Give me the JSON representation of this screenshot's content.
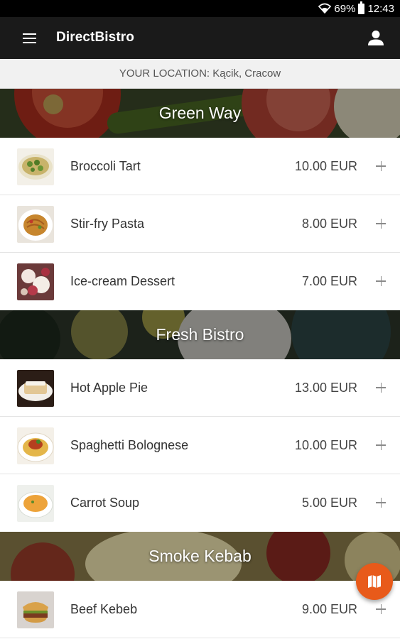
{
  "status_bar": {
    "battery": "69%",
    "time": "12:43",
    "icons": [
      "wifi-icon",
      "battery-icon"
    ]
  },
  "app_bar": {
    "title": "DirectBistro",
    "menu_icon": "menu-icon",
    "account_icon": "account-icon"
  },
  "location": {
    "text": "YOUR LOCATION: Kącik, Cracow"
  },
  "restaurants": [
    {
      "name": "Green Way",
      "dishes": [
        {
          "name": "Broccoli Tart",
          "price": "10.00 EUR"
        },
        {
          "name": "Stir-fry Pasta",
          "price": "8.00 EUR"
        },
        {
          "name": "Ice-cream Dessert",
          "price": "7.00 EUR"
        }
      ]
    },
    {
      "name": "Fresh Bistro",
      "dishes": [
        {
          "name": "Hot Apple Pie",
          "price": "13.00 EUR"
        },
        {
          "name": "Spaghetti Bolognese",
          "price": "10.00 EUR"
        },
        {
          "name": "Carrot Soup",
          "price": "5.00 EUR"
        }
      ]
    },
    {
      "name": "Smoke Kebab",
      "dishes": [
        {
          "name": "Beef Kebeb",
          "price": "9.00 EUR"
        }
      ]
    }
  ],
  "fab": {
    "icon": "map-icon"
  },
  "colors": {
    "app_bar": "#1a1a1a",
    "accent": "#e85a1a",
    "location_bg": "#f1f1f1"
  }
}
